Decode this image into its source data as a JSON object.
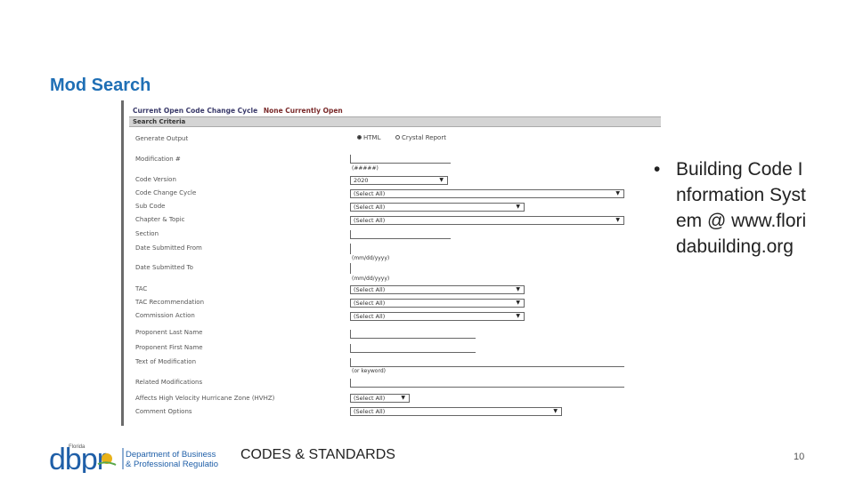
{
  "slide": {
    "title": "Mod Search",
    "footer_label": "CODES & STANDARDS",
    "page_number": "10",
    "bullet_text": "Building Code Information System @ www.floridabuilding.org"
  },
  "logo": {
    "small_text": "Florida",
    "letters": "dbpr",
    "line1": "Department of Business",
    "line2": "& Professional Regulation",
    "colors": {
      "letters": "#1f5fa8",
      "sun": "#e8b21a",
      "wave": "#5aa84a"
    }
  },
  "form": {
    "cycle_label": "Current Open Code Change Cycle",
    "cycle_value": "None Currently Open",
    "section_header": "Search Criteria",
    "generate_output_label": "Generate Output",
    "radio_html": "HTML",
    "radio_crystal": "Crystal Report",
    "selected_output": "HTML",
    "modification_label": "Modification #",
    "modification_hint": "(#####)",
    "code_version_label": "Code Version",
    "code_version_value": "2020",
    "code_change_cycle_label": "Code Change Cycle",
    "code_change_cycle_value": "(Select All)",
    "sub_code_label": "Sub Code",
    "sub_code_value": "(Select All)",
    "chapter_topic_label": "Chapter & Topic",
    "chapter_topic_value": "(Select All)",
    "section_label": "Section",
    "date_from_label": "Date Submitted From",
    "date_from_hint": "(mm/dd/yyyy)",
    "date_to_label": "Date Submitted To",
    "date_to_hint": "(mm/dd/yyyy)",
    "tac_label": "TAC",
    "tac_value": "(Select All)",
    "tac_rec_label": "TAC Recommendation",
    "tac_rec_value": "(Select All)",
    "commission_label": "Commission Action",
    "commission_value": "(Select All)",
    "last_name_label": "Proponent Last Name",
    "first_name_label": "Proponent First Name",
    "text_mod_label": "Text of Modification",
    "text_mod_hint": "(or keyword)",
    "related_label": "Related Modifications",
    "hvhz_label": "Affects High Velocity Hurricane Zone (HVHZ)",
    "hvhz_value": "(Select All)",
    "comment_label": "Comment Options",
    "comment_value": "(Select All)"
  }
}
